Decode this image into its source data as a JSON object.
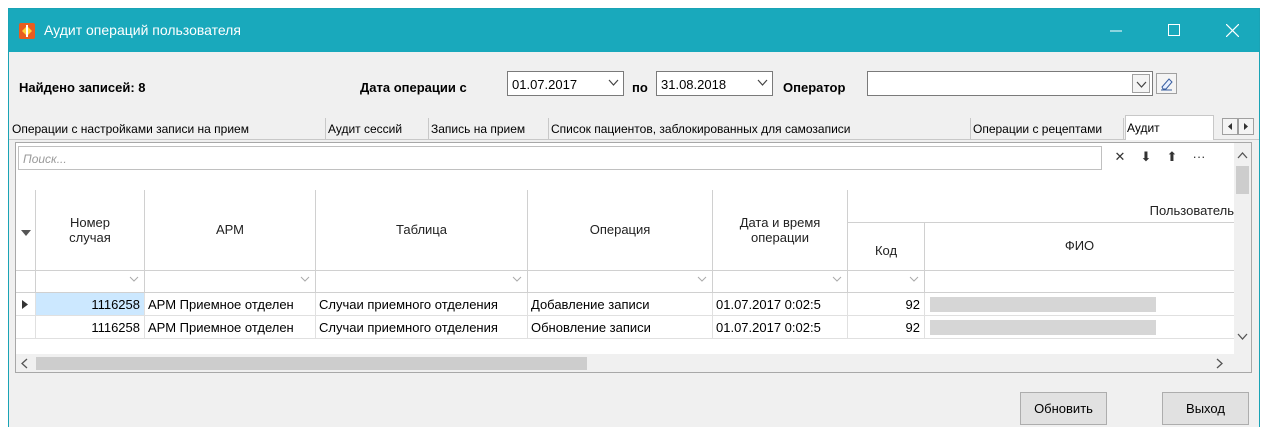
{
  "window": {
    "title": "Аудит операций пользователя"
  },
  "filter": {
    "found_label": "Найдено записей: 8",
    "date_from_label": "Дата операции с",
    "date_from": "01.07.2017",
    "date_to_label": "по",
    "date_to": "31.08.2018",
    "operator_label": "Оператор",
    "operator_value": ""
  },
  "tabs": [
    {
      "label": "Операции с настройками записи на прием"
    },
    {
      "label": "Аудит сессий"
    },
    {
      "label": "Запись на прием"
    },
    {
      "label": "Список пациентов, заблокированных для самозаписи"
    },
    {
      "label": "Операции с рецептами"
    },
    {
      "label": "Аудит"
    }
  ],
  "grid": {
    "search_placeholder": "Поиск...",
    "toolbar": {
      "clear": "✕",
      "down": "⬇",
      "up": "⬆",
      "more": "···"
    },
    "columns": {
      "case_number": "Номер случая",
      "arm": "АРМ",
      "table": "Таблица",
      "operation": "Операция",
      "datetime": "Дата и время операции",
      "user_group": "Пользователь",
      "code": "Код",
      "fio": "ФИО"
    },
    "rows": [
      {
        "case_number": "1116258",
        "arm": "АРМ Приемное отделен",
        "table": "Случаи приемного отделения",
        "operation": "Добавление записи",
        "datetime": "01.07.2017 0:02:5",
        "code": "92"
      },
      {
        "case_number": "1116258",
        "arm": "АРМ Приемное отделен",
        "table": "Случаи приемного отделения",
        "operation": "Обновление записи",
        "datetime": "01.07.2017 0:02:5",
        "code": "92"
      }
    ]
  },
  "buttons": {
    "refresh": "Обновить",
    "exit": "Выход"
  },
  "colors": {
    "titlebar": "#19a9bc",
    "selected_cell": "#cce8ff"
  }
}
